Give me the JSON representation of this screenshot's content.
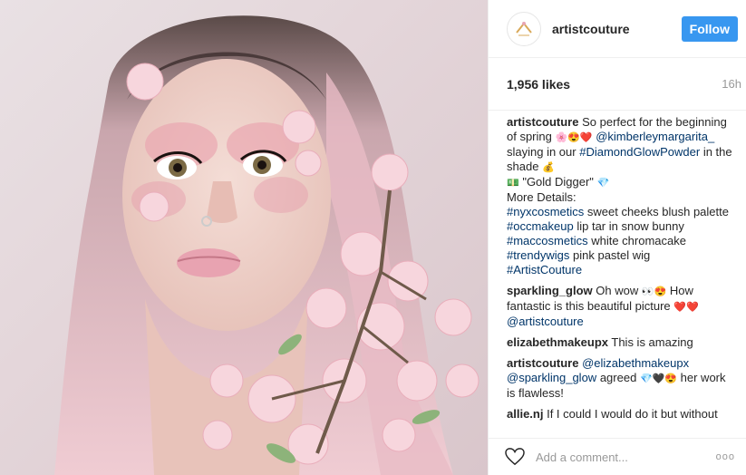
{
  "post": {
    "username": "artistcouture",
    "follow_label": "Follow",
    "likes": "1,956 likes",
    "time_ago": "16h",
    "add_comment_placeholder": "Add a comment...",
    "more_label": "ooo"
  },
  "caption": {
    "user": "artistcouture",
    "t1": "So perfect for the beginning of spring",
    "e1": "🌸😍❤️",
    "m1": "@kimberleymargarita_",
    "t2": "slaying in our",
    "h1": "#DiamondGlowPowder",
    "t3": "in the shade",
    "e2": "💰",
    "e3": "💵",
    "t4": "\"Gold Digger\"",
    "e4": "💎",
    "t5": "More Details:",
    "h2": "#nyxcosmetics",
    "t6": "sweet cheeks blush palette",
    "h3": "#occmakeup",
    "t7": "lip tar in snow bunny",
    "h4": "#maccosmetics",
    "t8": "white chromacake",
    "h5": "#trendywigs",
    "t9": "pink pastel wig",
    "h6": "#ArtistCouture"
  },
  "comments": [
    {
      "user": "sparkling_glow",
      "t1": "Oh wow",
      "e1": "👀😍",
      "t2": "How fantastic is this beautiful picture",
      "e2": "❤️❤️",
      "m1": "@artistcouture"
    },
    {
      "user": "elizabethmakeupx",
      "t1": "This is amazing"
    },
    {
      "user": "artistcouture",
      "m1": "@elizabethmakeupx",
      "m2": "@sparkling_glow",
      "t1": "agreed",
      "e1": "💎🖤😍",
      "t2": "her work is flawless!"
    },
    {
      "user": "allie.nj",
      "t1": "If I could I would do it but without the bottom lashes"
    }
  ],
  "colors": {
    "accent": "#3897f0",
    "link": "#003569",
    "blossom": "#f2c2ca"
  },
  "icons": {
    "heart": "heart-icon",
    "avatar": "artistcouture-logo-icon"
  }
}
